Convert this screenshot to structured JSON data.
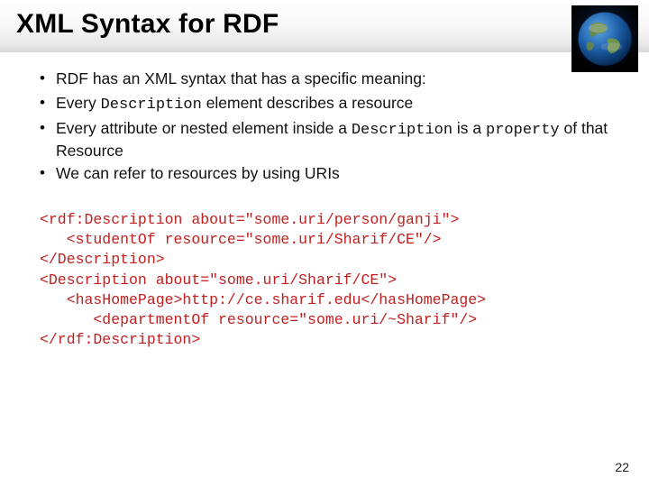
{
  "slide": {
    "title": "XML Syntax for RDF",
    "bullets": [
      {
        "pre": "RDF has an XML syntax that has a specific meaning:",
        "code1": "",
        "mid": "",
        "code2": "",
        "post": ""
      },
      {
        "pre": "Every ",
        "code1": "Description",
        "mid": " element describes a resource",
        "code2": "",
        "post": ""
      },
      {
        "pre": "Every attribute or nested element inside a ",
        "code1": "Description",
        "mid": " is a ",
        "code2": "property",
        "post": " of that Resource"
      },
      {
        "pre": "We can refer to resources by using URIs",
        "code1": "",
        "mid": "",
        "code2": "",
        "post": ""
      }
    ],
    "code": "<rdf:Description about=\"some.uri/person/ganji\">\n   <studentOf resource=\"some.uri/Sharif/CE\"/>\n</Description>\n<Description about=\"some.uri/Sharif/CE\">\n   <hasHomePage>http://ce.sharif.edu</hasHomePage>\n      <departmentOf resource=\"some.uri/~Sharif\"/>\n</rdf:Description>",
    "page_number": "22"
  }
}
